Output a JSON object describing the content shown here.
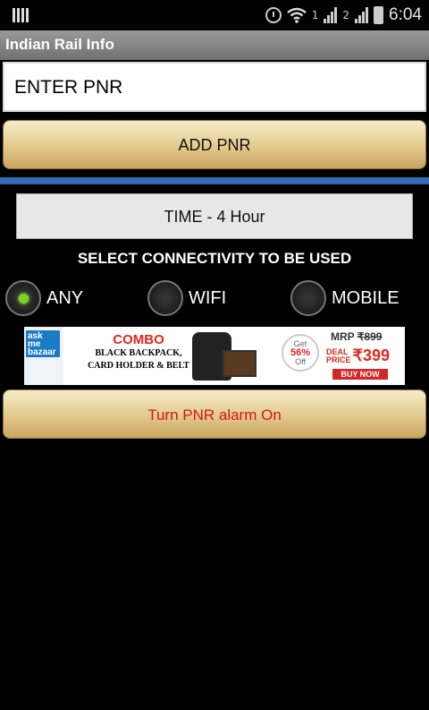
{
  "status_bar": {
    "sim1_label": "1",
    "sim2_label": "2",
    "time": "6:04",
    "icons": [
      "barcode-icon",
      "alarm-clock-icon",
      "wifi-icon",
      "signal-icon",
      "signal-icon",
      "battery-icon"
    ]
  },
  "app": {
    "title": "Indian Rail Info"
  },
  "pnr": {
    "placeholder": "ENTER PNR",
    "add_button": "ADD PNR"
  },
  "accent_color": "#2f6cb4",
  "time_button": "TIME - 4 Hour",
  "connectivity": {
    "label": "SELECT CONNECTIVITY TO BE USED",
    "options": [
      {
        "label": "ANY",
        "selected": true
      },
      {
        "label": "WIFI",
        "selected": false
      },
      {
        "label": "MOBILE",
        "selected": false
      }
    ]
  },
  "ad": {
    "logo_text": [
      "ask",
      "me",
      "bazaar"
    ],
    "headline": "COMBO",
    "line1": "BLACK BACKPACK,",
    "line2": "CARD HOLDER & BELT",
    "discount_top": "Get",
    "discount": "56%",
    "discount_bottom": "Off",
    "mrp_label": "MRP",
    "mrp_value": "₹899",
    "deal_label_1": "DEAL",
    "deal_label_2": "PRICE",
    "deal_value": "₹399",
    "cta": "BUY NOW"
  },
  "alarm_button": "Turn PNR alarm On"
}
